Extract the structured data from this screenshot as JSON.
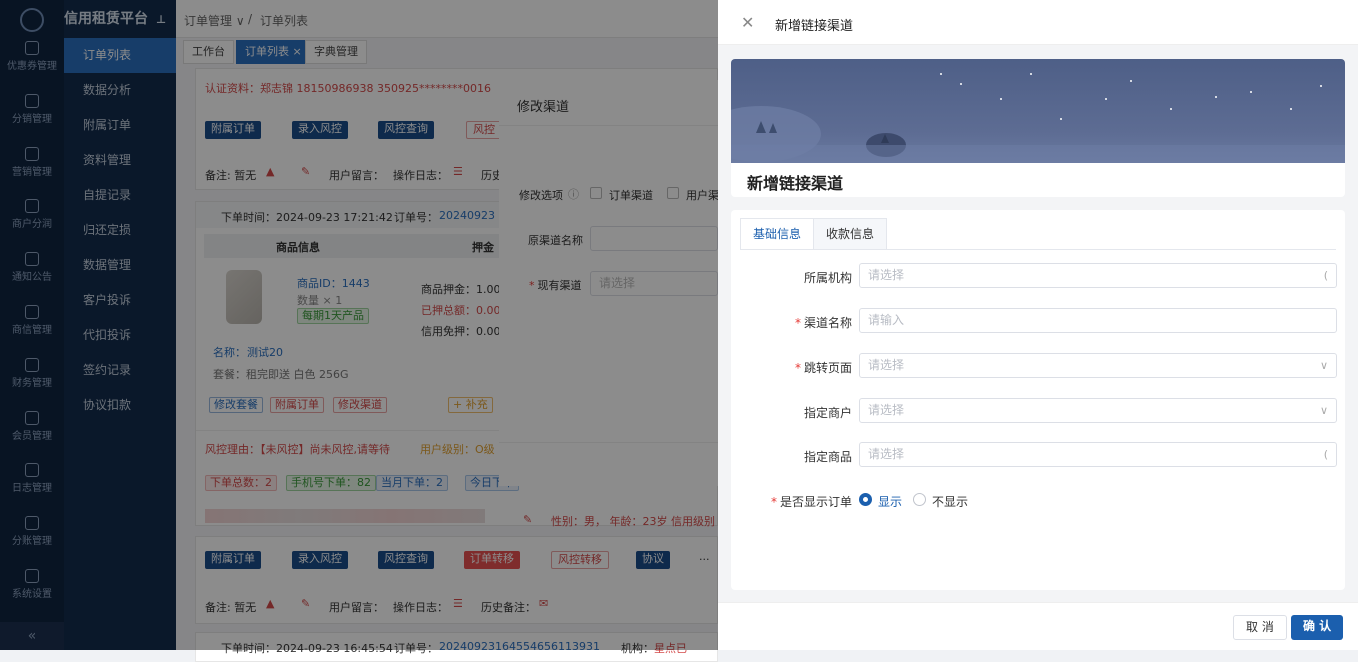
{
  "brand": "信用租赁平台",
  "iconbar": [
    "优惠券管理",
    "分销管理",
    "营销管理",
    "商户分润",
    "通知公告",
    "商信管理",
    "财务管理",
    "会员管理",
    "日志管理",
    "分账管理",
    "系统设置"
  ],
  "submenu": [
    "订单列表",
    "数据分析",
    "附属订单",
    "资料管理",
    "自提记录",
    "归还定损",
    "数据管理",
    "客户投诉",
    "代扣投诉",
    "签约记录",
    "协议扣款"
  ],
  "breadcrumb": {
    "parent": "订单管理",
    "sep": "/",
    "current": "订单列表"
  },
  "tabs": [
    "工作台",
    "订单列表",
    "字典管理"
  ],
  "order1": {
    "auth_info": "认证资料：郑志锦   18150986938   350925********0016",
    "buttons": [
      "附属订单",
      "录入风控",
      "风控查询",
      "风控"
    ],
    "remark": "备注: 暂无",
    "user_msg": "用户留言：",
    "op_log": "操作日志：",
    "history": "历史"
  },
  "order2": {
    "time": "下单时间：2024-09-23 17:21:42",
    "order_no_label": "订单号：",
    "order_no": "20240923",
    "col_goods": "商品信息",
    "col_deposit": "押金",
    "goods_id": "商品ID：1443",
    "qty": "数量 × 1",
    "badge": "每期1天产品",
    "name_label": "名称：",
    "name": "测试20",
    "package": "套餐：租完即送 白色 256G",
    "deposit1": "商品押金：1.00",
    "deposit2": "已押总额：0.00",
    "deposit3": "信用免押：0.00",
    "actions": [
      "修改套餐",
      "附属订单",
      "修改渠道"
    ],
    "add_btn": "+ 补充",
    "risk": "风控理由：【未风控】尚未风控,请等待",
    "user_level": "用户级别：O级",
    "stats": [
      "下单总数：2",
      "手机号下单：82",
      "当月下单：2",
      "今日下单"
    ],
    "profile": "性别：男，  年龄：23岁  信用级别",
    "buttons": [
      "附属订单",
      "录入风控",
      "风控查询",
      "订单转移",
      "风控转移",
      "协议"
    ],
    "more": "···",
    "remark": "备注: 暂无",
    "user_msg": "用户留言：",
    "op_log": "操作日志：",
    "history": "历史备注："
  },
  "order3": {
    "time": "下单时间：2024-09-23 16:45:54",
    "order_no_label": "订单号：",
    "order_no": "20240923164554656113931",
    "inst_label": "机构：",
    "inst": "星点已"
  },
  "modal": {
    "title": "修改渠道",
    "option_label": "修改选项",
    "opt1": "订单渠道",
    "opt2": "用户渠",
    "orig_label": "原渠道名称",
    "cur_label": "现有渠道",
    "cur_placeholder": "请选择"
  },
  "drawer": {
    "title": "新增链接渠道",
    "banner_title": "新增链接渠道",
    "tabs": [
      "基础信息",
      "收款信息"
    ],
    "fields": [
      {
        "label": "所属机构",
        "placeholder": "请选择",
        "required": false,
        "suffix": "("
      },
      {
        "label": "渠道名称",
        "placeholder": "请输入",
        "required": true,
        "suffix": ""
      },
      {
        "label": "跳转页面",
        "placeholder": "请选择",
        "required": true,
        "suffix": "∨"
      },
      {
        "label": "指定商户",
        "placeholder": "请选择",
        "required": false,
        "suffix": "∨"
      },
      {
        "label": "指定商品",
        "placeholder": "请选择",
        "required": false,
        "suffix": "("
      }
    ],
    "show_order_label": "是否显示订单",
    "radio_show": "显示",
    "radio_hide": "不显示",
    "show_selected": "显示",
    "cancel": "取 消",
    "confirm": "确 认"
  },
  "colors": {
    "primary": "#1b5fae",
    "danger": "#e53935",
    "sidebar": "#0f2541"
  }
}
